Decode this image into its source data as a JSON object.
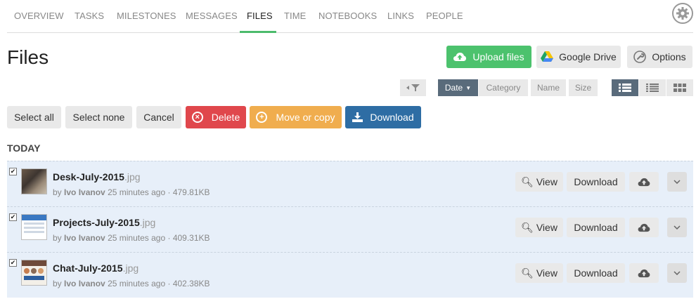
{
  "nav": {
    "tabs": [
      {
        "label": "OVERVIEW"
      },
      {
        "label": "TASKS"
      },
      {
        "label": "MILESTONES"
      },
      {
        "label": "MESSAGES"
      },
      {
        "label": "FILES"
      },
      {
        "label": "TIME"
      },
      {
        "label": "NOTEBOOKS"
      },
      {
        "label": "LINKS"
      },
      {
        "label": "PEOPLE"
      }
    ],
    "active_tab": "FILES",
    "settings_icon": "gear-icon"
  },
  "page": {
    "title": "Files"
  },
  "header_actions": {
    "upload_label": "Upload files",
    "gdrive_label": "Google Drive",
    "options_label": "Options"
  },
  "sort": {
    "filter_icon": "filter-icon",
    "options": [
      "Date",
      "Category",
      "Name",
      "Size"
    ],
    "selected": "Date",
    "view_modes": [
      "list-view-icon",
      "compact-list-icon",
      "grid-view-icon"
    ],
    "selected_view": "list-view-icon"
  },
  "bulk_actions": {
    "select_all": "Select all",
    "select_none": "Select none",
    "cancel": "Cancel",
    "delete": "Delete",
    "move_or_copy": "Move or copy",
    "download": "Download"
  },
  "section": {
    "label": "TODAY"
  },
  "files": [
    {
      "name": "Desk-July-2015",
      "ext": ".jpg",
      "by": "by",
      "author": "Ivo Ivanov",
      "time": "25 minutes ago",
      "sep": "·",
      "size": "479.81KB",
      "checked": true,
      "view": "View",
      "download": "Download"
    },
    {
      "name": "Projects-July-2015",
      "ext": ".jpg",
      "by": "by",
      "author": "Ivo Ivanov",
      "time": "25 minutes ago",
      "sep": "·",
      "size": "409.31KB",
      "checked": true,
      "view": "View",
      "download": "Download"
    },
    {
      "name": "Chat-July-2015",
      "ext": ".jpg",
      "by": "by",
      "author": "Ivo Ivanov",
      "time": "25 minutes ago",
      "sep": "·",
      "size": "402.38KB",
      "checked": true,
      "view": "View",
      "download": "Download"
    }
  ],
  "colors": {
    "accent_green": "#4cc26d",
    "delete_red": "#e0474c",
    "move_orange": "#f0ad4e",
    "download_blue": "#2e6da4",
    "row_bg": "#e7eff9"
  }
}
